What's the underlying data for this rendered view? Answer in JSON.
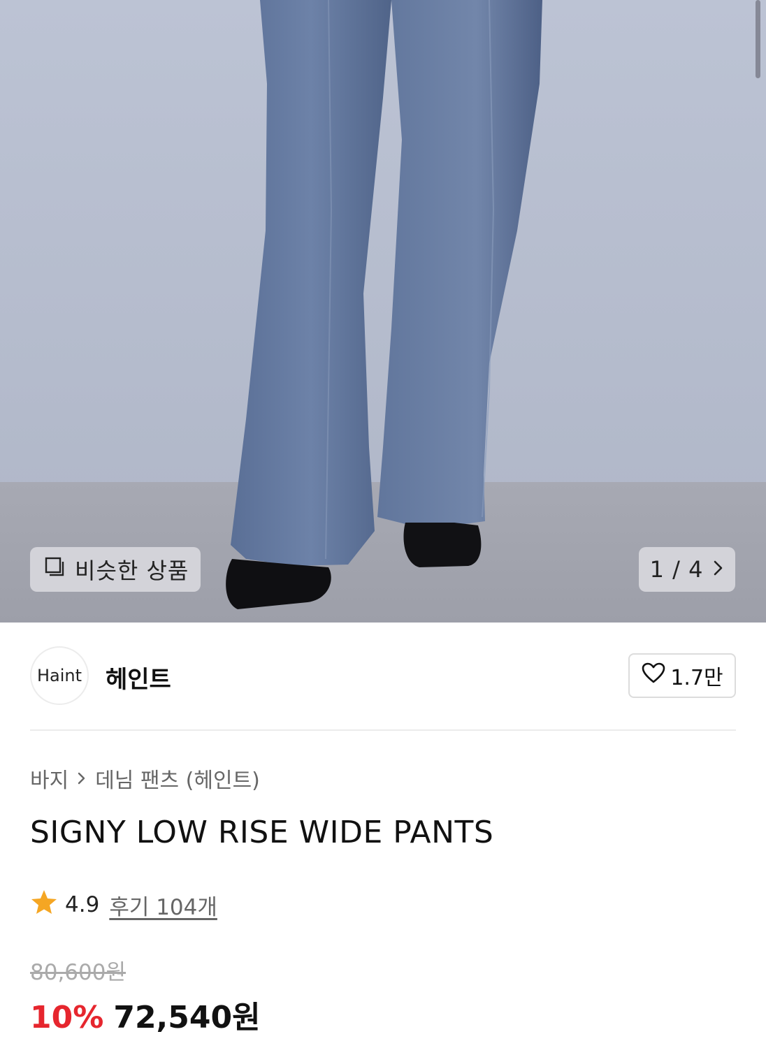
{
  "hero": {
    "similar_label": "비슷한 상품",
    "pager_label": "1 / 4"
  },
  "brand": {
    "logo_text": "Haint",
    "name": "헤인트",
    "like_count": "1.7만"
  },
  "breadcrumb": {
    "items": [
      "바지",
      "데님 팬츠 (헤인트)"
    ]
  },
  "product": {
    "title": "SIGNY LOW RISE WIDE PANTS",
    "rating": "4.9",
    "reviews": "후기 104개",
    "original_price": "80,600원",
    "discount": "10%",
    "final_price": "72,540원"
  },
  "colors": {
    "accent_red": "#e6262e",
    "star": "#f5a623"
  },
  "icons": [
    "similar-items-icon",
    "chevron-right-icon",
    "heart-icon",
    "star-icon"
  ]
}
